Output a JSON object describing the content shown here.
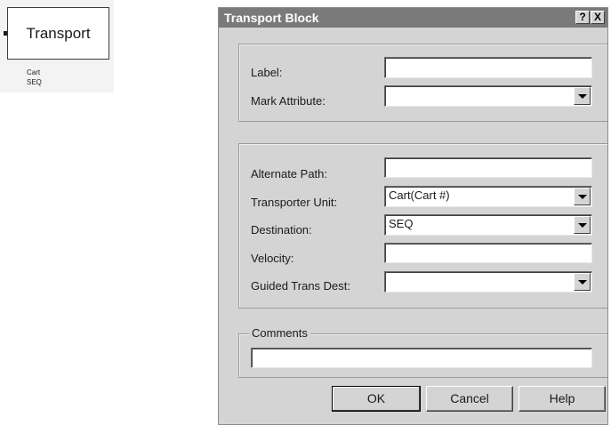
{
  "block": {
    "name": "Transport",
    "transporter_unit": "Cart",
    "destination": "SEQ"
  },
  "dialog": {
    "title": "Transport Block",
    "help_glyph": "?",
    "close_glyph": "X",
    "general": {
      "label_caption": "Label:",
      "label_value": "",
      "mark_attribute_caption": "Mark Attribute:",
      "mark_attribute_value": ""
    },
    "transport": {
      "alternate_path_caption": "Alternate Path:",
      "alternate_path_value": "",
      "transporter_unit_caption": "Transporter Unit:",
      "transporter_unit_value": "Cart(Cart #)",
      "destination_caption": "Destination:",
      "destination_value": "SEQ",
      "velocity_caption": "Velocity:",
      "velocity_value": "",
      "guided_trans_dest_caption": "Guided Trans Dest:",
      "guided_trans_dest_value": ""
    },
    "comments": {
      "caption": "Comments",
      "value": ""
    },
    "buttons": {
      "ok": "OK",
      "cancel": "Cancel",
      "help": "Help"
    }
  },
  "icons": {
    "dropdown": "chevron-down-icon",
    "help": "question-icon",
    "close": "close-icon"
  },
  "colors": {
    "dialog_bg": "#d4d4d4",
    "titlebar_bg": "#7a7a7a",
    "titlebar_text": "#ffffff"
  }
}
